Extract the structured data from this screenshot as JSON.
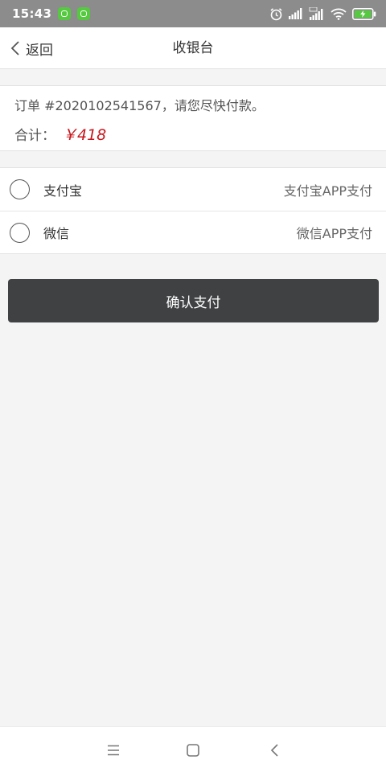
{
  "status_bar": {
    "time": "15:43",
    "notification_icons": [
      "app-badge-icon",
      "app-badge-icon"
    ],
    "indicator_icons": [
      "alarm-icon",
      "signal-icon",
      "signal-hd-icon",
      "wifi-icon",
      "battery-charging-icon"
    ]
  },
  "header": {
    "back_label": "返回",
    "title": "收银台"
  },
  "order": {
    "line": "订单 #2020102541567，请您尽快付款。",
    "total_label": "合计：",
    "total_amount": "￥418"
  },
  "payment_methods": [
    {
      "name": "支付宝",
      "description": "支付宝APP支付",
      "selected": false
    },
    {
      "name": "微信",
      "description": "微信APP支付",
      "selected": false
    }
  ],
  "confirm_label": "确认支付",
  "nav": {
    "icons": [
      "menu-icon",
      "home-icon",
      "back-icon"
    ]
  },
  "colors": {
    "status_bar": "#8c8c8c",
    "amount": "#c8161d",
    "button": "#3f4143",
    "badge": "#55c93f",
    "background": "#f4f4f4"
  }
}
